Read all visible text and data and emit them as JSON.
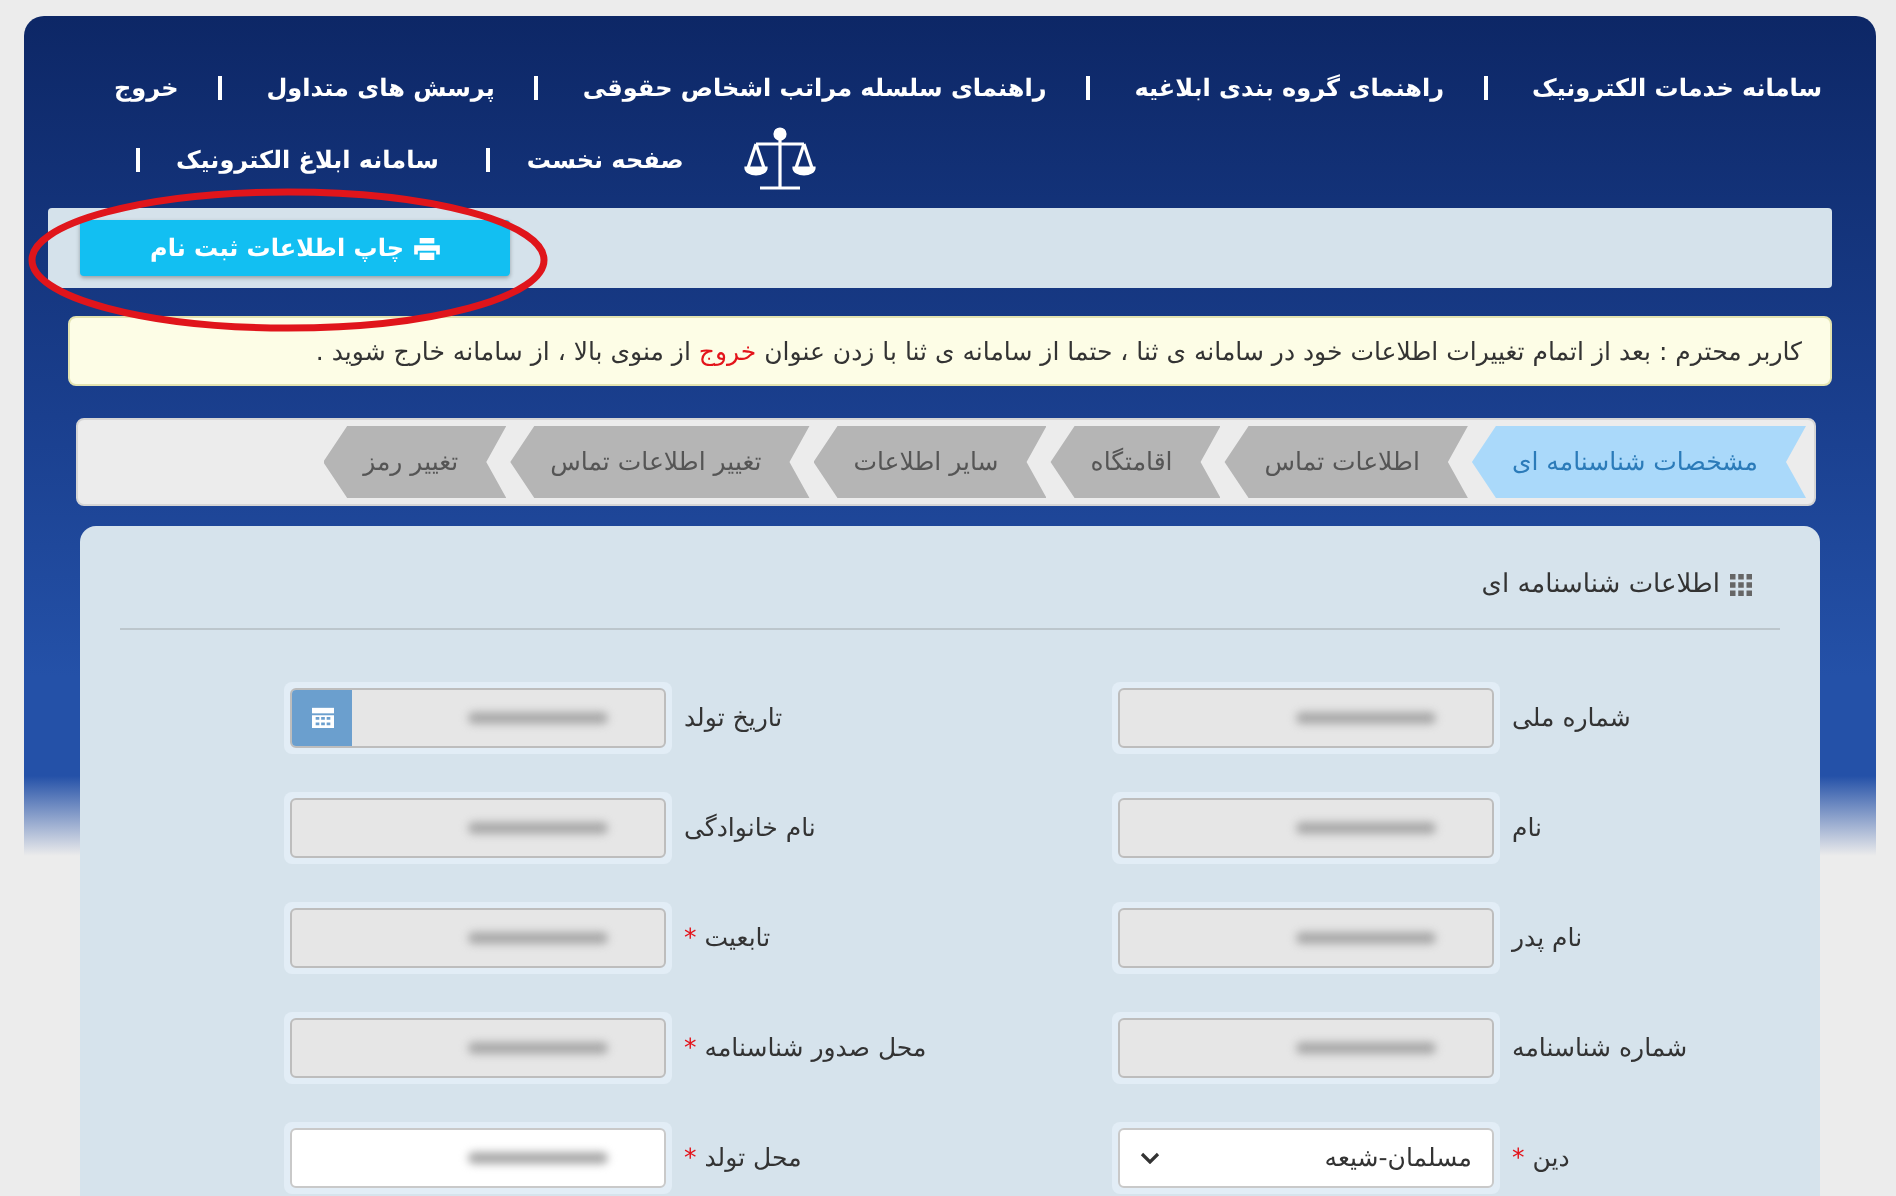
{
  "nav": {
    "top_links": [
      {
        "label": "سامانه خدمات الکترونیک"
      },
      {
        "label": "راهنمای گروه بندی ابلاغیه"
      },
      {
        "label": "راهنمای سلسله مراتب اشخاص حقوقی"
      },
      {
        "label": "پرسش های متداول"
      },
      {
        "label": "خروج"
      }
    ],
    "bottom_links": [
      {
        "label": "صفحه نخست"
      },
      {
        "label": "سامانه ابلاغ الکترونیک"
      }
    ]
  },
  "toolbar": {
    "print_button": "چاپ اطلاعات ثبت نام"
  },
  "notice": {
    "parts": [
      {
        "text": "کاربر محترم : بعد از اتمام تغییرات اطلاعات خود در سامانه ی ثنا ، حتما از سامانه ی ثنا با زدن عنوان ",
        "kind": "plain"
      },
      {
        "text": "خروج",
        "kind": "link"
      },
      {
        "text": " از منوی بالا ، از سامانه خارج شوید .",
        "kind": "plain"
      }
    ]
  },
  "tabs": [
    {
      "label": "مشخصات شناسنامه ای",
      "selected": true
    },
    {
      "label": "اطلاعات تماس",
      "selected": false
    },
    {
      "label": "اقامتگاه",
      "selected": false
    },
    {
      "label": "سایر اطلاعات",
      "selected": false
    },
    {
      "label": "تغییر اطلاعات تماس",
      "selected": false
    },
    {
      "label": "تغییر رمز",
      "selected": false
    }
  ],
  "form": {
    "title": "اطلاعات شناسنامه ای",
    "fields": [
      {
        "label": "شماره ملی",
        "disabled": true,
        "kind": "text",
        "redacted": true
      },
      {
        "label": "تاریخ تولد",
        "disabled": true,
        "kind": "date",
        "redacted": true
      },
      {
        "label": "نام",
        "disabled": true,
        "kind": "text",
        "redacted": true
      },
      {
        "label": "نام خانوادگی",
        "disabled": true,
        "kind": "text",
        "redacted": true
      },
      {
        "label": "نام پدر",
        "disabled": true,
        "kind": "text",
        "redacted": true
      },
      {
        "label": "تابعیت",
        "required_mark": "*",
        "disabled": true,
        "kind": "text",
        "redacted": true
      },
      {
        "label": "شماره شناسنامه",
        "disabled": true,
        "kind": "text",
        "redacted": true
      },
      {
        "label": "محل صدور شناسنامه",
        "required_mark": "*",
        "disabled": true,
        "kind": "text",
        "redacted": true
      },
      {
        "label": "دین",
        "required_mark": "*",
        "disabled": false,
        "kind": "select",
        "value": "مسلمان-شیعه"
      },
      {
        "label": "محل تولد",
        "required_mark": "*",
        "disabled": false,
        "kind": "text",
        "redacted": true
      }
    ]
  }
}
